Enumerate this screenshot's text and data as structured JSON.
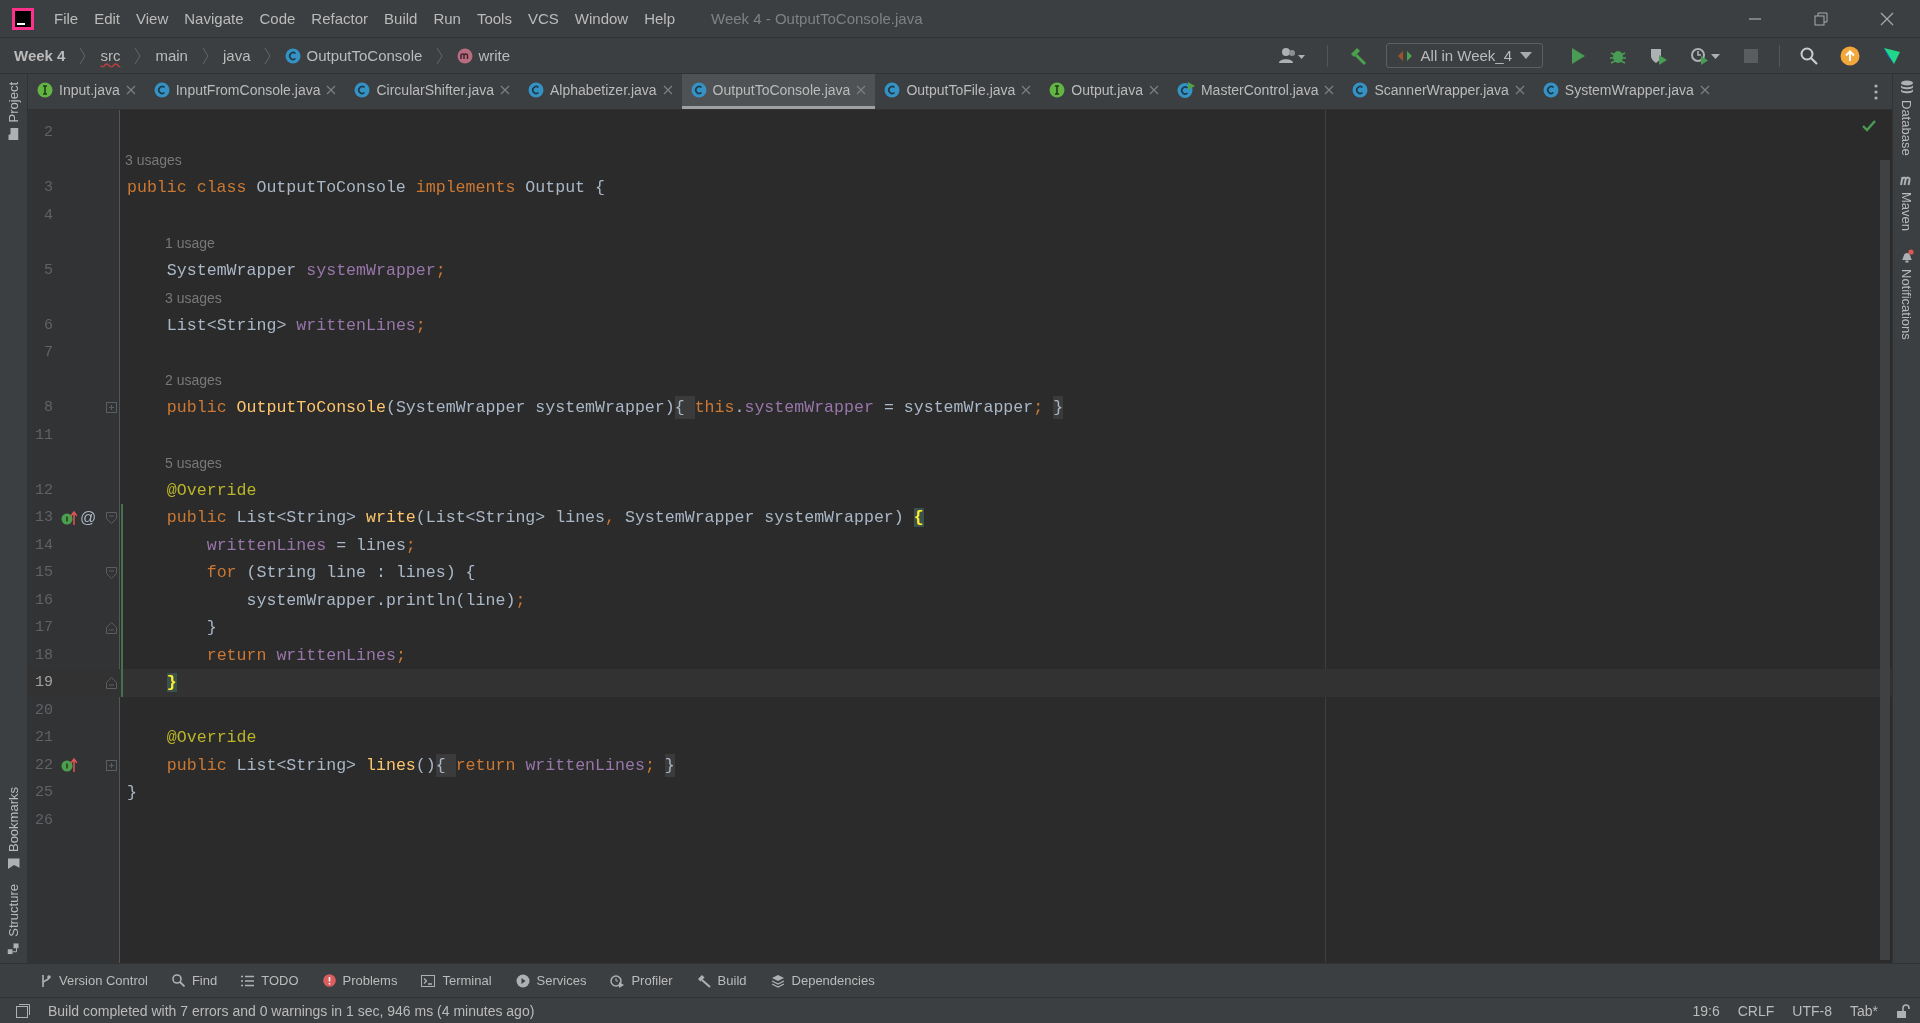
{
  "window": {
    "title": "Week 4 - OutputToConsole.java"
  },
  "menu": [
    "File",
    "Edit",
    "View",
    "Navigate",
    "Code",
    "Refactor",
    "Build",
    "Run",
    "Tools",
    "VCS",
    "Window",
    "Help"
  ],
  "breadcrumbs": [
    {
      "label": "Week 4",
      "kind": "project"
    },
    {
      "label": "src",
      "kind": "folder-error"
    },
    {
      "label": "main",
      "kind": "folder"
    },
    {
      "label": "java",
      "kind": "folder"
    },
    {
      "label": "OutputToConsole",
      "kind": "class"
    },
    {
      "label": "write",
      "kind": "method"
    }
  ],
  "run_config": {
    "label": "All in Week_4"
  },
  "tabs": [
    {
      "label": "Input.java",
      "kind": "interface",
      "selected": false
    },
    {
      "label": "InputFromConsole.java",
      "kind": "class",
      "selected": false
    },
    {
      "label": "CircularShifter.java",
      "kind": "class",
      "selected": false
    },
    {
      "label": "Alphabetizer.java",
      "kind": "class",
      "selected": false
    },
    {
      "label": "OutputToConsole.java",
      "kind": "class",
      "selected": true
    },
    {
      "label": "OutputToFile.java",
      "kind": "class",
      "selected": false
    },
    {
      "label": "Output.java",
      "kind": "interface",
      "selected": false
    },
    {
      "label": "MasterControl.java",
      "kind": "main",
      "selected": false
    },
    {
      "label": "ScannerWrapper.java",
      "kind": "class",
      "selected": false
    },
    {
      "label": "SystemWrapper.java",
      "kind": "class",
      "selected": false
    }
  ],
  "left_tools": [
    {
      "label": "Project",
      "kind": "folder"
    }
  ],
  "left_tools_bottom": [
    {
      "label": "Bookmarks",
      "kind": "bookmark"
    },
    {
      "label": "Structure",
      "kind": "structure"
    }
  ],
  "right_tools": [
    {
      "label": "Database",
      "kind": "database"
    },
    {
      "label": "Maven",
      "kind": "maven"
    },
    {
      "label": "Notifications",
      "kind": "bell"
    }
  ],
  "editor": {
    "rows": [
      {
        "kind": "code",
        "number": "2",
        "current": false,
        "changed": false,
        "tokens": []
      },
      {
        "kind": "hint",
        "text": "3 usages"
      },
      {
        "kind": "code",
        "number": "3",
        "current": false,
        "changed": false,
        "tokens": [
          {
            "t": "public class ",
            "kind": "keyword"
          },
          {
            "t": "OutputToConsole ",
            "kind": "plain"
          },
          {
            "t": "implements ",
            "kind": "keyword"
          },
          {
            "t": "Output {",
            "kind": "plain"
          }
        ]
      },
      {
        "kind": "code",
        "number": "4",
        "current": false,
        "changed": false,
        "tokens": []
      },
      {
        "kind": "hint",
        "text": "1 usage"
      },
      {
        "kind": "code",
        "number": "5",
        "current": false,
        "changed": false,
        "tokens": [
          {
            "t": "    SystemWrapper ",
            "kind": "plain"
          },
          {
            "t": "systemWrapper",
            "kind": "field"
          },
          {
            "t": ";",
            "kind": "keyword"
          }
        ]
      },
      {
        "kind": "hint",
        "text": "3 usages"
      },
      {
        "kind": "code",
        "number": "6",
        "current": false,
        "changed": false,
        "tokens": [
          {
            "t": "    List<String> ",
            "kind": "plain"
          },
          {
            "t": "writtenLines",
            "kind": "field"
          },
          {
            "t": ";",
            "kind": "keyword"
          }
        ]
      },
      {
        "kind": "code",
        "number": "7",
        "current": false,
        "changed": false,
        "tokens": []
      },
      {
        "kind": "hint",
        "text": "2 usages"
      },
      {
        "kind": "code",
        "number": "8",
        "current": false,
        "changed": false,
        "collapsed": true,
        "tokens": [
          {
            "t": "    public ",
            "kind": "keyword"
          },
          {
            "t": "OutputToConsole",
            "kind": "method"
          },
          {
            "t": "(SystemWrapper systemWrapper)",
            "kind": "plain"
          },
          {
            "t": "{ ",
            "kind": "folded"
          },
          {
            "t": "this",
            "kind": "keyword"
          },
          {
            "t": ".",
            "kind": "plain"
          },
          {
            "t": "systemWrapper",
            "kind": "field"
          },
          {
            "t": " = systemWrapper",
            "kind": "plain"
          },
          {
            "t": ";",
            "kind": "keyword"
          },
          {
            "t": " }",
            "kind": "folded"
          }
        ]
      },
      {
        "kind": "code",
        "number": "11",
        "current": false,
        "changed": false,
        "tokens": []
      },
      {
        "kind": "hint",
        "text": "5 usages"
      },
      {
        "kind": "code",
        "number": "12",
        "current": false,
        "changed": false,
        "tokens": [
          {
            "t": "    @Override",
            "kind": "annotation"
          }
        ]
      },
      {
        "kind": "code",
        "number": "13",
        "current": false,
        "changed": true,
        "fold_start": true,
        "implemented": true,
        "gutter_text": "@",
        "tokens": [
          {
            "t": "    public ",
            "kind": "keyword"
          },
          {
            "t": "List<String> ",
            "kind": "plain"
          },
          {
            "t": "write",
            "kind": "method"
          },
          {
            "t": "(List<String> lines",
            "kind": "plain"
          },
          {
            "t": ",",
            "kind": "keyword"
          },
          {
            "t": " SystemWrapper systemWrapper) ",
            "kind": "plain"
          },
          {
            "t": "{",
            "kind": "match"
          }
        ]
      },
      {
        "kind": "code",
        "number": "14",
        "current": false,
        "changed": true,
        "tokens": [
          {
            "t": "        writtenLines",
            "kind": "field"
          },
          {
            "t": " = lines",
            "kind": "plain"
          },
          {
            "t": ";",
            "kind": "keyword"
          }
        ]
      },
      {
        "kind": "code",
        "number": "15",
        "current": false,
        "changed": true,
        "fold_start": true,
        "tokens": [
          {
            "t": "        for ",
            "kind": "keyword"
          },
          {
            "t": "(String line : lines) {",
            "kind": "plain"
          }
        ]
      },
      {
        "kind": "code",
        "number": "16",
        "current": false,
        "changed": true,
        "tokens": [
          {
            "t": "            systemWrapper.println(line)",
            "kind": "plain"
          },
          {
            "t": ";",
            "kind": "keyword"
          }
        ]
      },
      {
        "kind": "code",
        "number": "17",
        "current": false,
        "changed": true,
        "fold_end": true,
        "tokens": [
          {
            "t": "        }",
            "kind": "plain"
          }
        ]
      },
      {
        "kind": "code",
        "number": "18",
        "current": false,
        "changed": true,
        "tokens": [
          {
            "t": "        return ",
            "kind": "keyword"
          },
          {
            "t": "writtenLines",
            "kind": "field"
          },
          {
            "t": ";",
            "kind": "keyword"
          }
        ]
      },
      {
        "kind": "code",
        "number": "19",
        "current": true,
        "changed": true,
        "fold_end": true,
        "tokens": [
          {
            "t": "    }",
            "kind": "match"
          }
        ]
      },
      {
        "kind": "code",
        "number": "20",
        "current": false,
        "changed": false,
        "tokens": []
      },
      {
        "kind": "code",
        "number": "21",
        "current": false,
        "changed": false,
        "tokens": [
          {
            "t": "    @Override",
            "kind": "annotation"
          }
        ]
      },
      {
        "kind": "code",
        "number": "22",
        "current": false,
        "changed": false,
        "collapsed": true,
        "implemented": true,
        "tokens": [
          {
            "t": "    public ",
            "kind": "keyword"
          },
          {
            "t": "List<String> ",
            "kind": "plain"
          },
          {
            "t": "lines",
            "kind": "method"
          },
          {
            "t": "()",
            "kind": "plain"
          },
          {
            "t": "{ ",
            "kind": "folded"
          },
          {
            "t": "return ",
            "kind": "keyword"
          },
          {
            "t": "writtenLines",
            "kind": "field"
          },
          {
            "t": ";",
            "kind": "keyword"
          },
          {
            "t": " }",
            "kind": "folded"
          }
        ]
      },
      {
        "kind": "code",
        "number": "25",
        "current": false,
        "changed": false,
        "tokens": [
          {
            "t": "}",
            "kind": "plain"
          }
        ]
      },
      {
        "kind": "code",
        "number": "26",
        "current": false,
        "changed": false,
        "tokens": []
      }
    ]
  },
  "tool_windows": [
    {
      "label": "Version Control",
      "kind": "vcs"
    },
    {
      "label": "Find",
      "kind": "search"
    },
    {
      "label": "TODO",
      "kind": "list"
    },
    {
      "label": "Problems",
      "kind": "error"
    },
    {
      "label": "Terminal",
      "kind": "terminal"
    },
    {
      "label": "Services",
      "kind": "play"
    },
    {
      "label": "Profiler",
      "kind": "gauge"
    },
    {
      "label": "Build",
      "kind": "hammer"
    },
    {
      "label": "Dependencies",
      "kind": "layers"
    }
  ],
  "status_bar": {
    "message": "Build completed with 7 errors and 0 warnings in 1 sec, 946 ms (4 minutes ago)",
    "items": [
      "19:6",
      "CRLF",
      "UTF-8",
      "Tab*"
    ]
  }
}
